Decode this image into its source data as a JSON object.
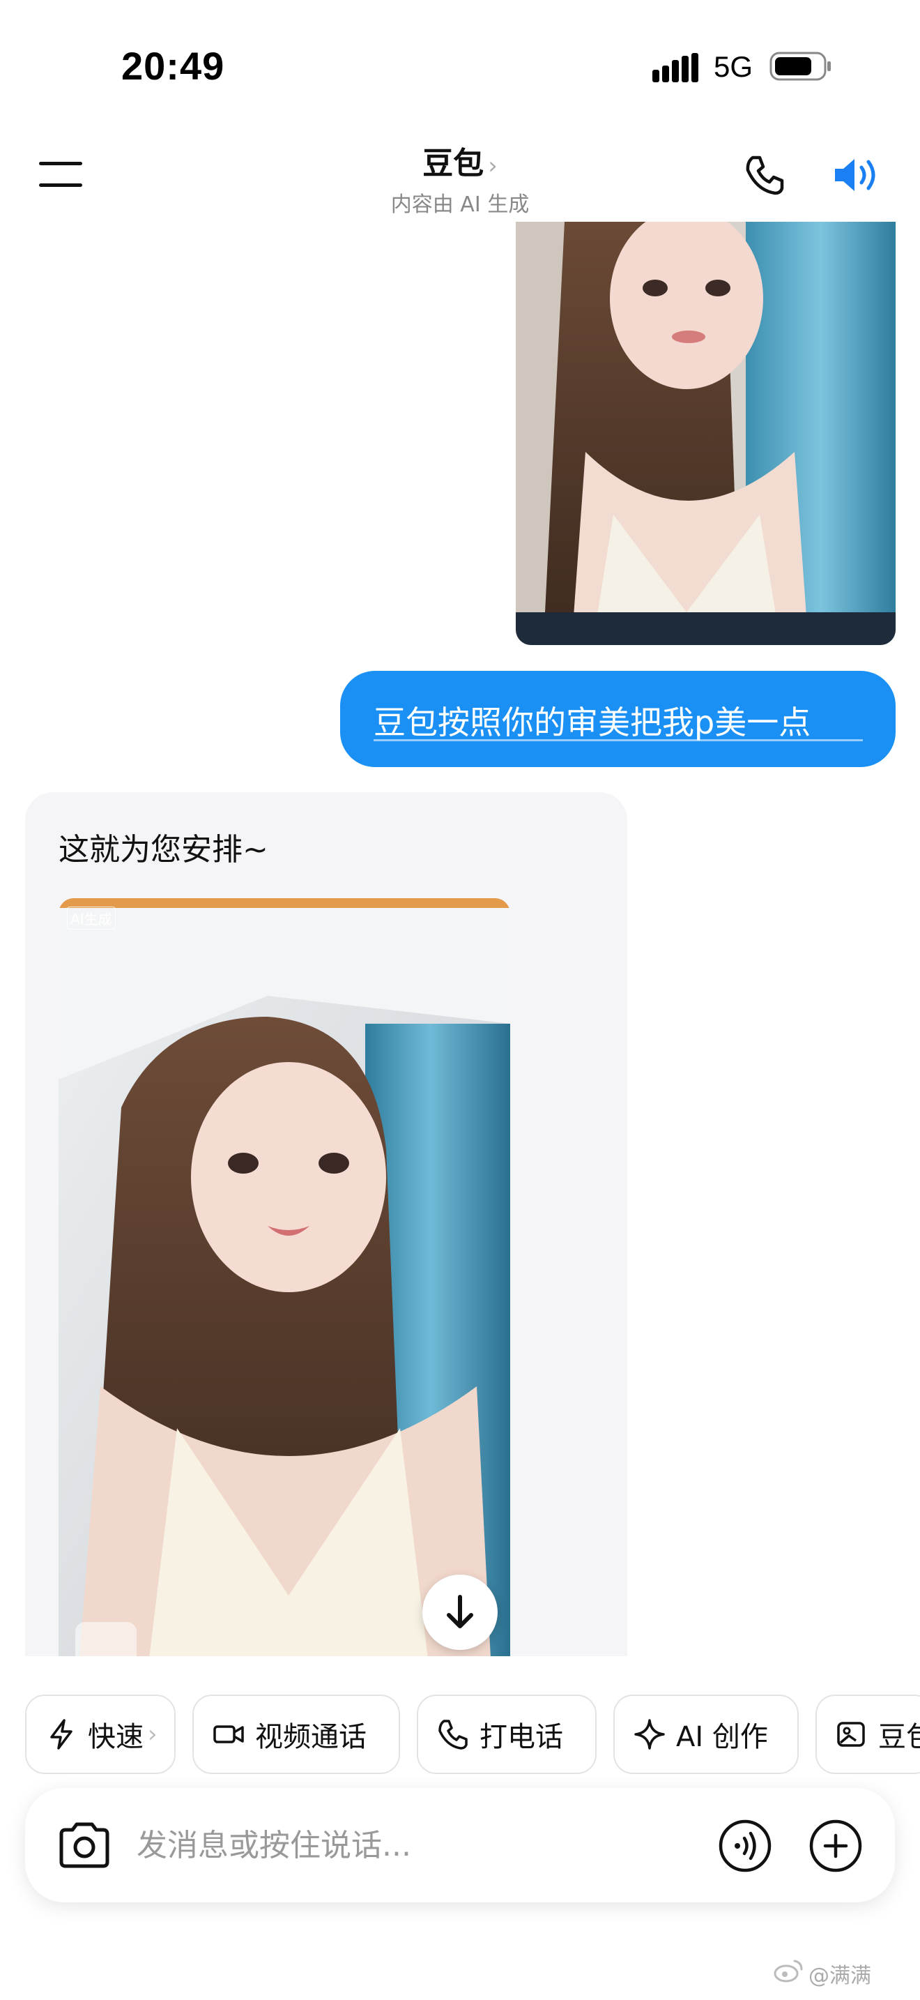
{
  "status_bar": {
    "time": "20:49",
    "network": "5G"
  },
  "header": {
    "title": "豆包",
    "title_chevron": "›",
    "subtitle": "内容由 AI 生成"
  },
  "messages": {
    "user_text": "豆包按照你的审美把我p美一点",
    "ai_text": "这就为您安排~",
    "ai_image_label": "AI生成"
  },
  "quick_actions": [
    {
      "label": "快速",
      "icon": "bolt-icon",
      "chevron": "›"
    },
    {
      "label": "视频通话",
      "icon": "video-call-icon"
    },
    {
      "label": "打电话",
      "icon": "phone-icon"
    },
    {
      "label": "AI 创作",
      "icon": "sparkle-icon"
    },
    {
      "label": "豆包",
      "icon": "image-edit-icon"
    }
  ],
  "input": {
    "placeholder": "发消息或按住说话..."
  },
  "watermark": "@满满",
  "colors": {
    "accent": "#1a90f5",
    "bubble_user": "#1a90f5",
    "bubble_ai": "#f5f5f7"
  }
}
